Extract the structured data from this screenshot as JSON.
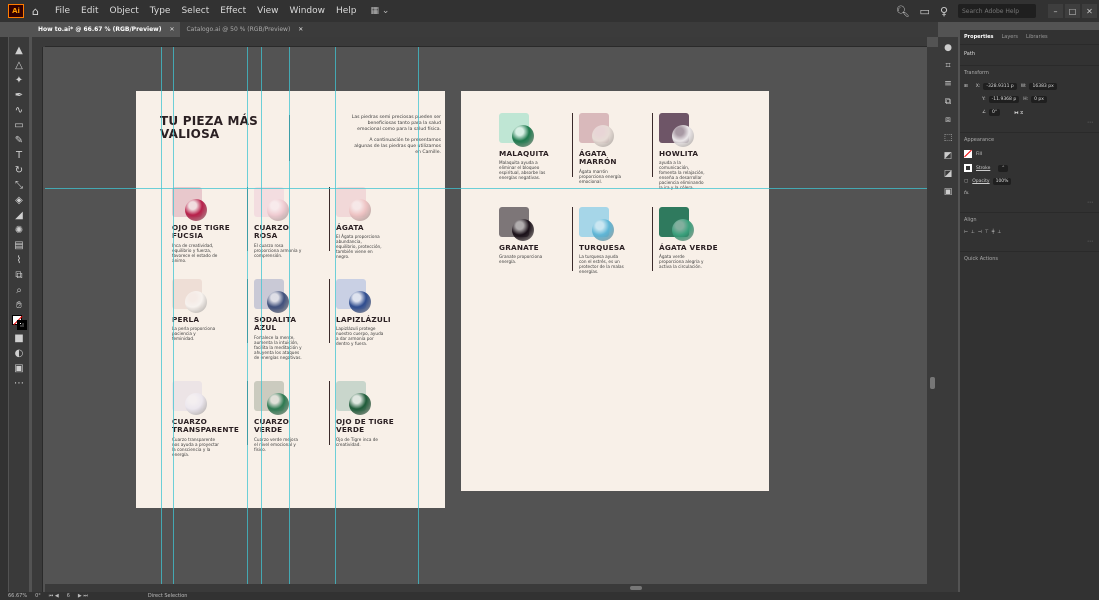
{
  "menubar": {
    "logo": "Ai",
    "items": [
      "File",
      "Edit",
      "Object",
      "Type",
      "Select",
      "Effect",
      "View",
      "Window",
      "Help"
    ],
    "search_placeholder": "Search Adobe Help"
  },
  "tabs": [
    {
      "label": "How to.ai* @ 66.67 % (RGB/Preview)",
      "active": true
    },
    {
      "label": "Catalogo.ai @ 50 % (RGB/Preview)",
      "active": false
    }
  ],
  "page1": {
    "title_line1": "TU PIEZA MÁS",
    "title_line2": "VALIOSA",
    "intro_p1": [
      "Las piedras semi preciosas pueden ser",
      "beneficiosas tanto para la salud",
      "emocional como para la salud física."
    ],
    "intro_p2": [
      "A continuación te presentamos",
      "algunas de las piedras que utilizamos",
      "en Camille."
    ],
    "cards": [
      {
        "name": [
          "OJO DE TIGRE",
          "FUCSIA"
        ],
        "desc": [
          "Inca de creatividad,",
          "equilibrio y fuerza,",
          "favorece el estado de",
          "ánimo."
        ],
        "bg": "#e8c8cc",
        "stone": "#b8204a"
      },
      {
        "name": [
          "CUARZO",
          "ROSA"
        ],
        "desc": [
          "El cuarzo rosa",
          "proporciona armonía y",
          "comprensión."
        ],
        "bg": "#f3dde0",
        "stone": "#f0ccd2"
      },
      {
        "name": [
          "ÁGATA"
        ],
        "desc": [
          "El Ágata proporciona",
          "abundancia,",
          "equilibrio, protección,",
          "también viene en",
          "negro."
        ],
        "bg": "#f1d8d8",
        "stone": "#eec4c4"
      },
      {
        "name": [
          "PERLA"
        ],
        "desc": [
          "La perla proporciona",
          "paciencia y",
          "feminidad."
        ],
        "bg": "#eeded6",
        "stone": "#f7f2ee"
      },
      {
        "name": [
          "SODALITA",
          "AZUL"
        ],
        "desc": [
          "Fortalece la mente,",
          "aumenta la intuición,",
          "facilita la meditación y",
          "ahuyenta los ataques",
          "de energías negativas."
        ],
        "bg": "#c9c9d6",
        "stone": "#41517d"
      },
      {
        "name": [
          "LAPIZLÁZULI"
        ],
        "desc": [
          "Lapizlázuli protege",
          "nuestro cuerpo, ayuda",
          "a dar armonía por",
          "dentro y fuera."
        ],
        "bg": "#c9d0e4",
        "stone": "#2f4d8f"
      },
      {
        "name": [
          "CUARZO",
          "TRANSPARENTE"
        ],
        "desc": [
          "Cuarzo transparente",
          "nos ayuda a proyectar",
          "la consciencia y la",
          "energía."
        ],
        "bg": "#ece4e6",
        "stone": "#ece7ee"
      },
      {
        "name": [
          "CUARZO",
          "VERDE"
        ],
        "desc": [
          "Cuarzo verde mejora",
          "el nivel emocional y",
          "físico."
        ],
        "bg": "#cbcbbf",
        "stone": "#2e7a52"
      },
      {
        "name": [
          "OJO DE TIGRE",
          "VERDE"
        ],
        "desc": [
          "Ojo de Tigre inca de",
          "creatividad."
        ],
        "bg": "#c9d6cc",
        "stone": "#1f5c3a"
      }
    ]
  },
  "page2": {
    "cards": [
      {
        "name": [
          "MALAQUITA"
        ],
        "desc": [
          "Malaquita ayuda a",
          "eliminar el bloqueo",
          "espiritual, absorbe las",
          "energías negativas."
        ],
        "bg": "#bfe6d4",
        "stone": "#1f7a4e"
      },
      {
        "name": [
          "ÁGATA",
          "MARRÓN"
        ],
        "desc": [
          "Ágata marrón",
          "proporciona energía",
          "emocional."
        ],
        "bg": "#d9b9bb",
        "stone": "#e7dcd6"
      },
      {
        "name": [
          "HOWLITA"
        ],
        "desc": [
          "ayuda a la",
          "comunicación,",
          "fomenta la relajación,",
          "enseña a desarrollar",
          "paciencia eliminando",
          "la ira y la cólera."
        ],
        "bg": "#6e5567",
        "stone": "#ece8ea"
      },
      {
        "name": [
          "GRANATE"
        ],
        "desc": [
          "Granate proporciona",
          "energía."
        ],
        "bg": "#7d7678",
        "stone": "#1a1018"
      },
      {
        "name": [
          "TURQUESA"
        ],
        "desc": [
          "La turquesa ayuda",
          "con el estrés, es un",
          "protector de la malas",
          "energías."
        ],
        "bg": "#a6d6e8",
        "stone": "#5fb6d6"
      },
      {
        "name": [
          "ÁGATA VERDE"
        ],
        "desc": [
          "Ágata verde",
          "proporciona alegría y",
          "activa la circulación."
        ],
        "bg": "#2f7a5e",
        "stone": "#3aa07c"
      }
    ]
  },
  "rightpanel": {
    "tabs": [
      "Properties",
      "Layers",
      "Libraries"
    ],
    "path_label": "Path",
    "transform_label": "Transform",
    "x_label": "X:",
    "x_value": "-328.9311 p",
    "w_label": "W:",
    "w_value": "16383 px",
    "y_label": "Y:",
    "y_value": "-11.9368 p",
    "h_label": "H:",
    "h_value": "0 px",
    "angle_value": "0°",
    "appearance_label": "Appearance",
    "fill_label": "Fill",
    "stroke_label": "Stroke",
    "opacity_label": "Opacity",
    "opacity_value": "100%",
    "fx_label": "fx.",
    "align_label": "Align",
    "quick_actions_label": "Quick Actions"
  },
  "statusbar": {
    "zoom": "66.67%",
    "rotation": "0°",
    "artboard_num": "6",
    "tool": "Direct Selection"
  },
  "colors": {
    "guide": "#3fc4d1",
    "artboard": "#f8f0e8",
    "text_dark": "#2a1f22"
  }
}
